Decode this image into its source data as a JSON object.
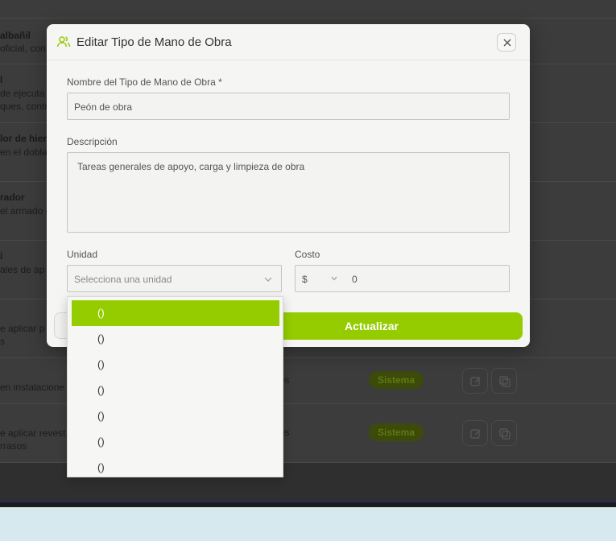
{
  "background": {
    "rows": [
      {
        "line1": "albañil",
        "line2": [
          "oficial, con"
        ],
        "extra": "",
        "badge": ""
      },
      {
        "line1": "l",
        "line2": [
          "de ejecuta",
          "ques, contr"
        ],
        "extra": "",
        "badge": ""
      },
      {
        "line1": "lor de hierr",
        "line2": [
          "en el dobla"
        ],
        "extra": "",
        "badge": ""
      },
      {
        "line1": "rador",
        "line2": [
          "el armado d"
        ],
        "extra": "",
        "badge": ""
      },
      {
        "line1": "i",
        "line2": [
          "ales de ap"
        ],
        "extra": "",
        "badge": ""
      },
      {
        "line1": "",
        "line2": [
          "e aplicar p",
          "s"
        ],
        "extra": "",
        "badge": ""
      },
      {
        "line1": "",
        "line2": [
          "en instalacione"
        ],
        "extra": "datos",
        "badge": "Sistema"
      },
      {
        "line1": "",
        "line2": [
          "e aplicar revest",
          "rrasos"
        ],
        "extra": "datos",
        "badge": "Sistema"
      }
    ]
  },
  "modal": {
    "title": "Editar Tipo de Mano de Obra",
    "name_label": "Nombre del Tipo de Mano de Obra *",
    "name_value": "Peón de obra",
    "description_label": "Descripción",
    "description_value": "Tareas generales de apoyo, carga y limpieza de obra",
    "unit_label": "Unidad",
    "unit_placeholder": "Selecciona una unidad",
    "cost_label": "Costo",
    "currency": "$",
    "cost_value": "0",
    "submit_label": "Actualizar"
  },
  "dropdown": {
    "options": [
      "()",
      "()",
      "()",
      "()",
      "()",
      "()",
      "()"
    ],
    "selected_index": 0
  },
  "colors": {
    "accent": "#94cc00",
    "badge": "#3c4a0a"
  }
}
